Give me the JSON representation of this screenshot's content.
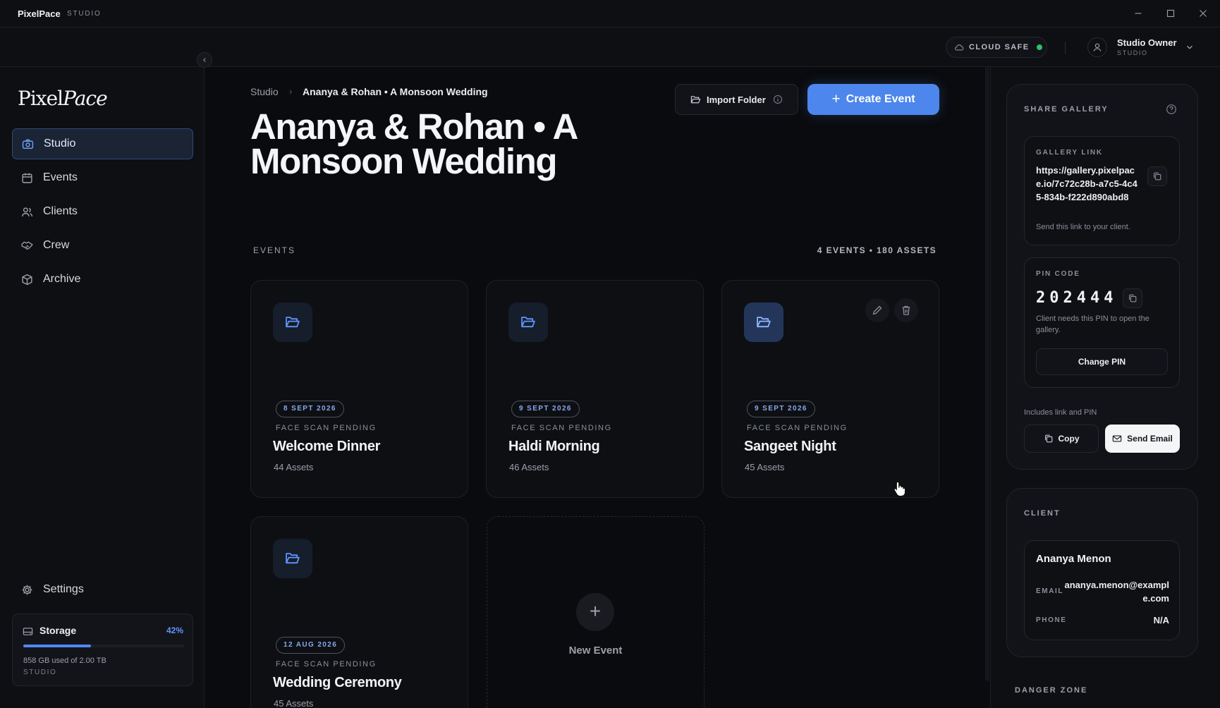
{
  "window": {
    "app_name": "PixelPace",
    "app_subtitle": "STUDIO"
  },
  "header": {
    "cloud_status": "CLOUD SAFE",
    "cloud_status_color": "#2fbf6a",
    "user_name": "Studio Owner",
    "user_role": "STUDIO"
  },
  "sidebar": {
    "logo_part1": "Pixel",
    "logo_part2": "Pace",
    "items": [
      {
        "label": "Studio",
        "icon": "camera-icon",
        "active": true
      },
      {
        "label": "Events",
        "icon": "calendar-icon"
      },
      {
        "label": "Clients",
        "icon": "users-icon"
      },
      {
        "label": "Crew",
        "icon": "handshake-icon"
      },
      {
        "label": "Archive",
        "icon": "box-icon"
      }
    ],
    "settings_label": "Settings",
    "storage": {
      "title": "Storage",
      "percent_label": "42%",
      "percent": 0.42,
      "used_text": "858 GB used of 2.00 TB",
      "tier": "STUDIO"
    }
  },
  "main": {
    "breadcrumb_root": "Studio",
    "breadcrumb_sep": "›",
    "breadcrumb_current": "Ananya & Rohan • A Monsoon Wedding",
    "title": "Ananya & Rohan • A Monsoon Wedding",
    "import_label": "Import Folder",
    "create_label": "Create Event",
    "events_label": "EVENTS",
    "events_count": "4 EVENTS • 180 ASSETS",
    "events": [
      {
        "date": "8 SEPT 2026",
        "status": "FACE SCAN PENDING",
        "name": "Welcome Dinner",
        "assets": "44 Assets"
      },
      {
        "date": "9 SEPT 2026",
        "status": "FACE SCAN PENDING",
        "name": "Haldi Morning",
        "assets": "46 Assets"
      },
      {
        "date": "9 SEPT 2026",
        "status": "FACE SCAN PENDING",
        "name": "Sangeet Night",
        "assets": "45 Assets"
      },
      {
        "date": "12 AUG 2026",
        "status": "FACE SCAN PENDING",
        "name": "Wedding Ceremony",
        "assets": "45 Assets"
      }
    ],
    "new_event_label": "New Event"
  },
  "share": {
    "title": "SHARE GALLERY",
    "link_label": "GALLERY LINK",
    "link": "https://gallery.pixelpace.io/7c72c28b-a7c5-4c45-834b-f222d890abd8",
    "link_note": "Send this link to your client.",
    "pin_label": "PIN CODE",
    "pin": "202444",
    "pin_note": "Client needs this PIN to open the gallery.",
    "change_pin": "Change PIN",
    "includes": "Includes link and PIN",
    "copy": "Copy",
    "send_email": "Send Email"
  },
  "client": {
    "title": "CLIENT",
    "name": "Ananya Menon",
    "email_label": "EMAIL",
    "email": "ananya.menon@example.com",
    "phone_label": "PHONE",
    "phone": "N/A"
  },
  "danger_zone": "DANGER ZONE",
  "colors": {
    "accent": "#4d86ec",
    "background": "#0b0c0f"
  }
}
